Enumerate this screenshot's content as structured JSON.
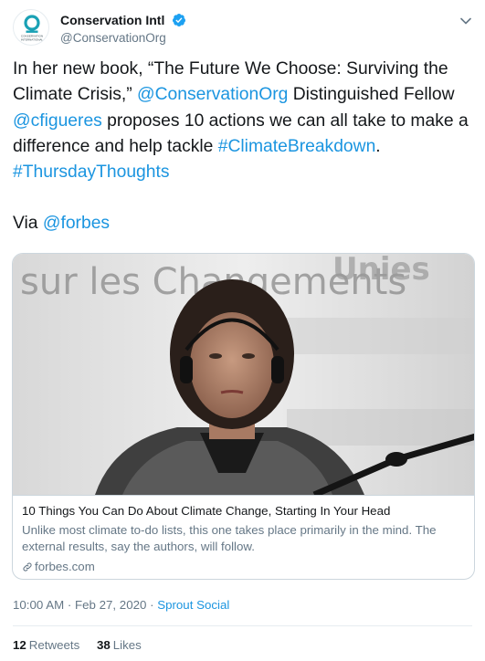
{
  "author": {
    "display_name": "Conservation Intl",
    "handle": "@ConservationOrg",
    "avatar_text_line1": "CONSERVATION",
    "avatar_text_line2": "INTERNATIONAL",
    "avatar_icon": "conservation-logo",
    "verified_icon": "verified-badge-icon"
  },
  "tweet": {
    "text_part1": "In her new book, “The Future We Choose: Surviving the Climate Crisis,” ",
    "mention1": "@ConservationOrg",
    "text_part2": " Distinguished Fellow ",
    "mention2": "@cfigueres",
    "text_part3": " proposes 10 actions we can all take to make a difference and help tackle ",
    "hashtag1": "#ClimateBreakdown",
    "text_part4": ". ",
    "hashtag2": "#ThursdayThoughts",
    "via_label": "Via ",
    "via_mention": "@forbes"
  },
  "card": {
    "image_bg_text_line1": "sur les Changements",
    "image_bg_text_line2": "Unies",
    "title": "10 Things You Can Do About Climate Change, Starting In Your Head",
    "description": "Unlike most climate to-do lists, this one takes place primarily in the mind. The external results, say the authors, will follow.",
    "domain": "forbes.com",
    "link_icon": "link-icon"
  },
  "meta": {
    "time": "10:00 AM",
    "separator1": " · ",
    "date": "Feb 27, 2020",
    "separator2": " · ",
    "source": "Sprout Social"
  },
  "stats": {
    "retweets_count": "12",
    "retweets_label": "Retweets",
    "likes_count": "38",
    "likes_label": "Likes"
  },
  "colors": {
    "link": "#1b95e0",
    "text": "#14171a",
    "muted": "#657786",
    "border": "#ccd6dd",
    "logo_teal": "#1aa1b5"
  }
}
